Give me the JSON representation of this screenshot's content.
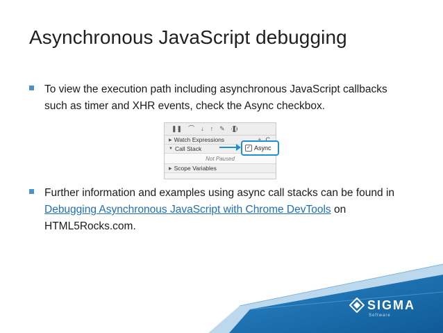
{
  "slide": {
    "title": "Asynchronous JavaScript debugging",
    "bullets": [
      {
        "text_line1": "To view the execution path including asynchronous JavaScript callbacks",
        "text_line2": "such as timer and XHR events, check the Async checkbox."
      },
      {
        "text_line1": "Further information and examples using async call stacks can be found in",
        "link_text": "Debugging Asynchronous JavaScript with Chrome DevTools",
        "after_link": " on",
        "text_line3": "HTML5Rocks.com."
      }
    ]
  },
  "devtools": {
    "toolbar_icons": [
      "pause-icon",
      "step-over-icon",
      "step-into-icon",
      "step-out-icon",
      "deactivate-breakpoints-icon",
      "pause-on-exceptions-icon"
    ],
    "watch_expressions": "Watch Expressions",
    "call_stack": "Call Stack",
    "async_label": "Async",
    "not_paused": "Not Paused",
    "scope_variables": "Scope Variables",
    "plus": "+",
    "refresh": "C"
  },
  "brand": {
    "name": "SIGMA",
    "subtitle": "Software",
    "accent_color": "#1e8fcf"
  }
}
